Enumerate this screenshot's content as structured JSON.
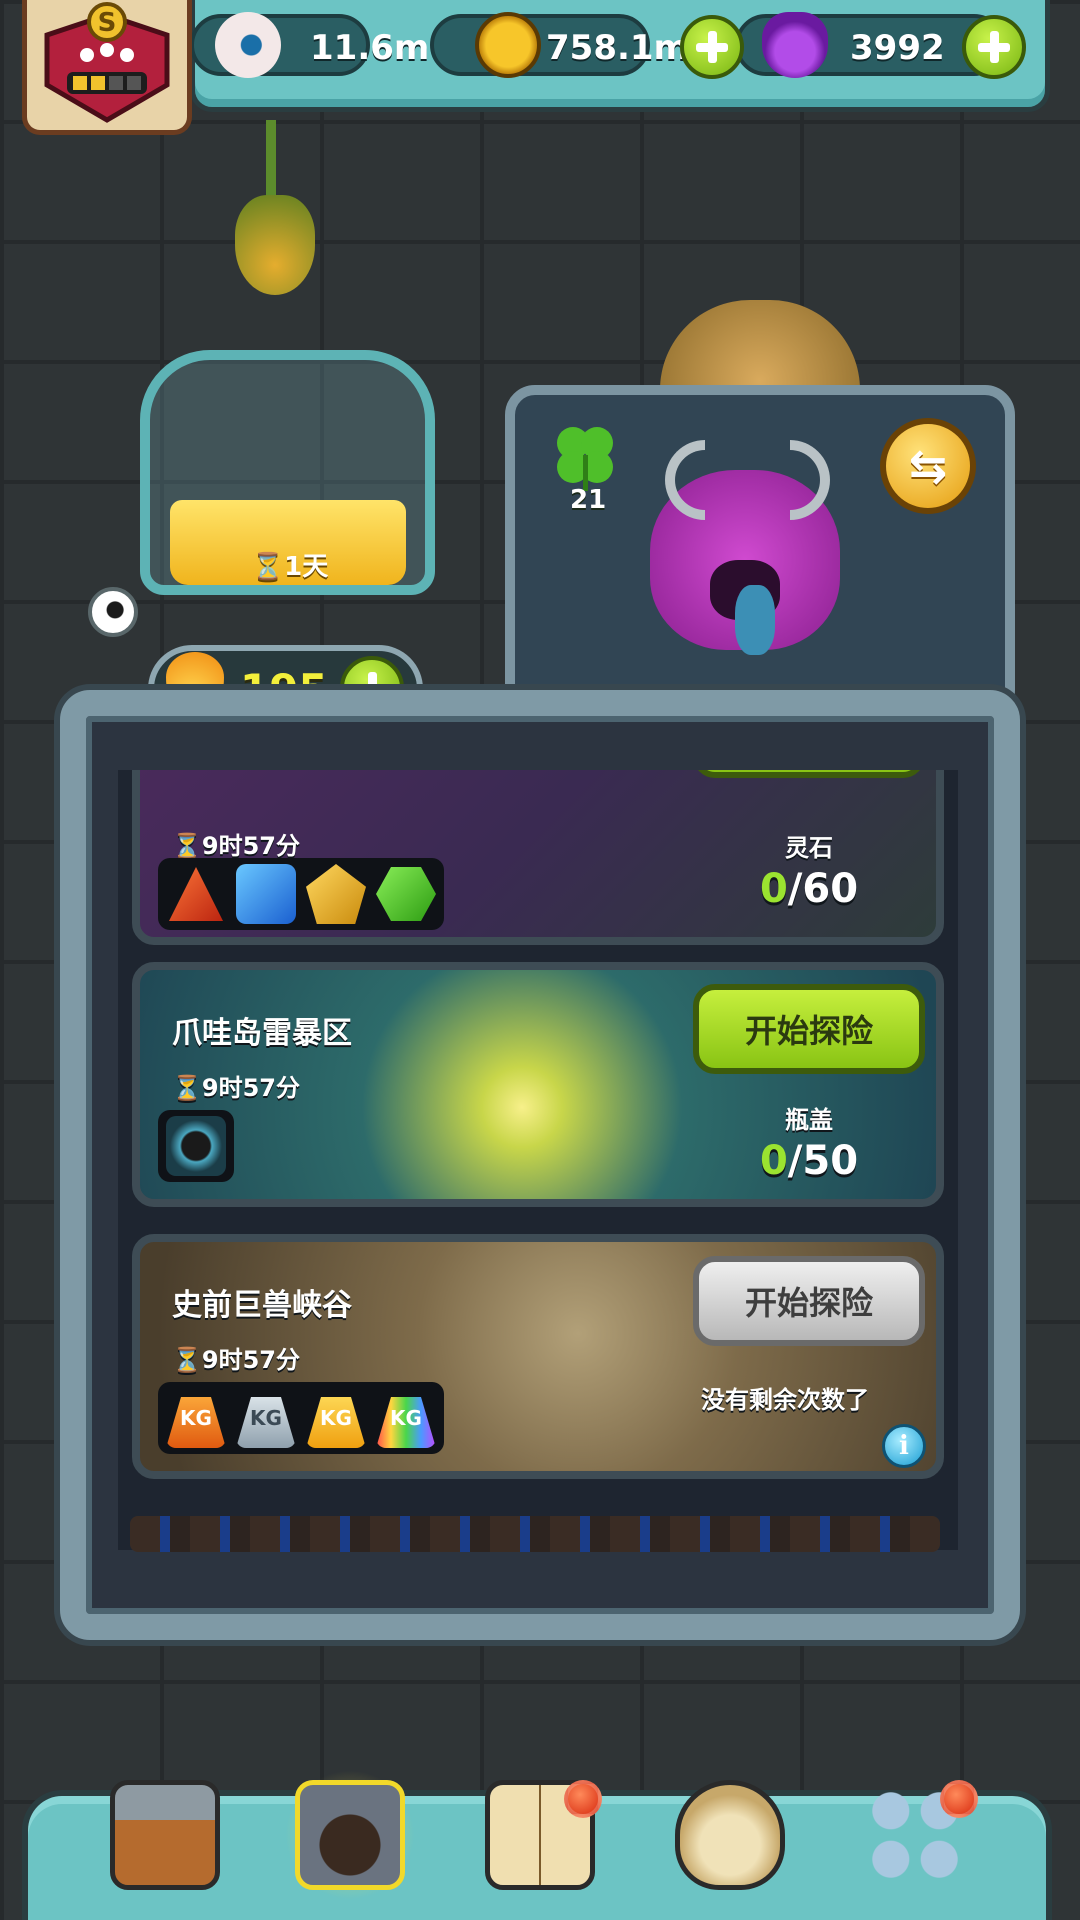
{
  "resources": {
    "eyeballs": "11.6m",
    "coins": "758.1m",
    "potions": "3992"
  },
  "brew": {
    "timer": "⏳1天"
  },
  "energy": {
    "value": "195"
  },
  "machine": {
    "clover_count": "21",
    "swap_glyph": "⇆"
  },
  "expeditions": [
    {
      "title": "",
      "timer": "⏳9时57分",
      "button": "",
      "reward_label": "灵石",
      "progress_current": "0",
      "progress_max": "/60",
      "rewards": [
        "red-gem",
        "blue-gem",
        "yellow-gem",
        "green-gem"
      ]
    },
    {
      "title": "爪哇岛雷暴区",
      "timer": "⏳9时57分",
      "button": "开始探险",
      "reward_label": "瓶盖",
      "progress_current": "0",
      "progress_max": "/50",
      "rewards": [
        "bottle-cap"
      ]
    },
    {
      "title": "史前巨兽峡谷",
      "timer": "⏳9时57分",
      "button": "开始探险",
      "status_text": "没有剩余次数了",
      "rewards": [
        {
          "icon": "orange-weight",
          "text": "KG"
        },
        {
          "icon": "gray-weight",
          "text": "KG"
        },
        {
          "icon": "yellow-weight",
          "text": "KG"
        },
        {
          "icon": "rainbow-weight",
          "text": "KG"
        }
      ]
    }
  ],
  "bottom_nav": [
    {
      "name": "shop"
    },
    {
      "name": "expedition",
      "active": true
    },
    {
      "name": "book",
      "badge": true
    },
    {
      "name": "money-bag"
    },
    {
      "name": "grid-menu",
      "badge": true
    }
  ],
  "colors": {
    "teal_bar": "#6cc4c4",
    "green_button": "#89c414",
    "gray_button": "#b8b8b8",
    "energy_text": "#f3ef3b",
    "progress_current": "#9be330"
  }
}
